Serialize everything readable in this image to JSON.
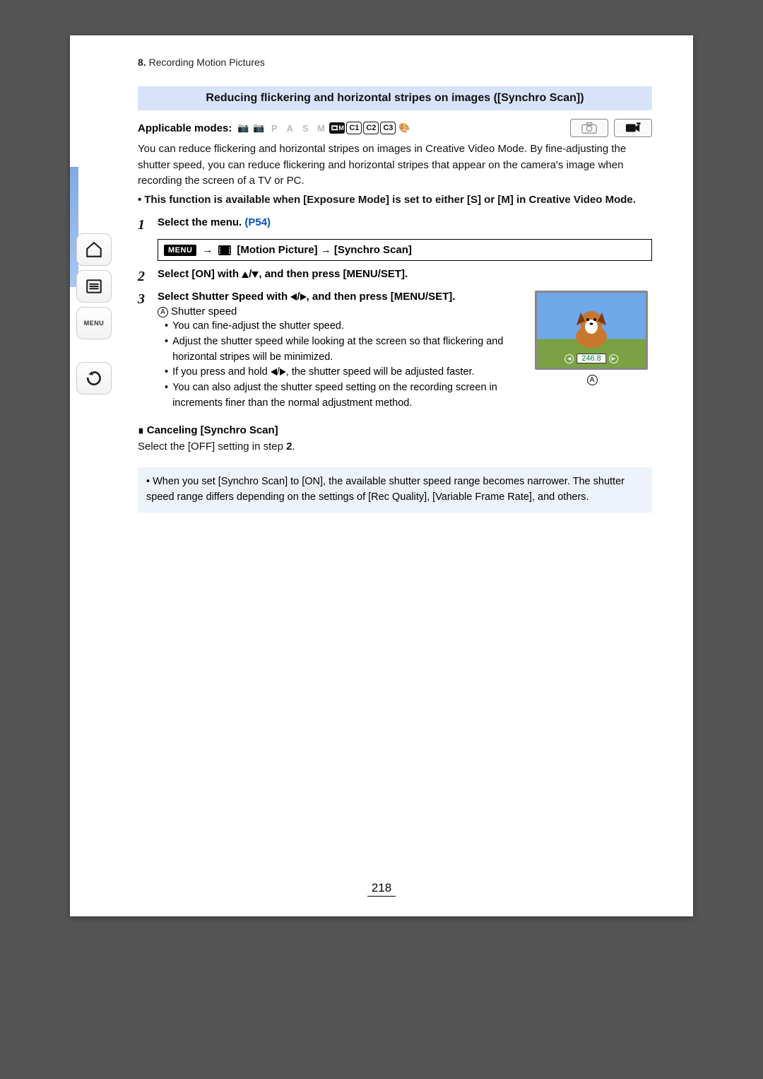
{
  "breadcrumb": {
    "num": "8.",
    "text": "Recording Motion Pictures"
  },
  "section_title": "Reducing flickering and horizontal stripes on images ([Synchro Scan])",
  "modes_label": "Applicable modes:",
  "mode_icons": [
    "iA",
    "iA+",
    "P",
    "A",
    "S",
    "M",
    "filmM",
    "C1",
    "C2",
    "C3",
    "palette"
  ],
  "intro": "You can reduce flickering and horizontal stripes on images in Creative Video Mode. By fine-adjusting the shutter speed, you can reduce flickering and horizontal stripes that appear on the camera's image when recording the screen of a TV or PC.",
  "intro_bullet": "This function is available when [Exposure Mode] is set to either [S] or [M] in Creative Video Mode.",
  "steps": [
    {
      "num": "1",
      "bold": "Select the menu.",
      "link": "(P54)"
    },
    {
      "num": "2",
      "bold": "Select [ON] with ▲/▼, and then press [MENU/SET]."
    },
    {
      "num": "3",
      "bold": "Select Shutter Speed with ◀/▶, and then press [MENU/SET]."
    }
  ],
  "menu_path": {
    "chip": "MENU",
    "arrow": "→",
    "items": "[Motion Picture] → [Synchro Scan]"
  },
  "circ_a": "A",
  "shutter_label": "Shutter speed",
  "sub_items": [
    "You can fine-adjust the shutter speed.",
    "Adjust the shutter speed while looking at the screen so that flickering and horizontal stripes will be minimized.",
    "If you press and hold ◀/▶, the shutter speed will be adjusted faster.",
    "You can also adjust the shutter speed setting on the recording screen in increments finer than the normal adjustment method."
  ],
  "illus_value": "246.8",
  "illus_label_a": "A",
  "cancel_heading": "Canceling [Synchro Scan]",
  "cancel_body_a": "Select the [OFF] setting in step ",
  "cancel_body_b": "2",
  "cancel_body_c": ".",
  "note": "When you set [Synchro Scan] to [ON], the available shutter speed range becomes narrower. The shutter speed range differs depending on the settings of [Rec Quality], [Variable Frame Rate], and others.",
  "page_number": "218",
  "sidebar_menu": "MENU"
}
